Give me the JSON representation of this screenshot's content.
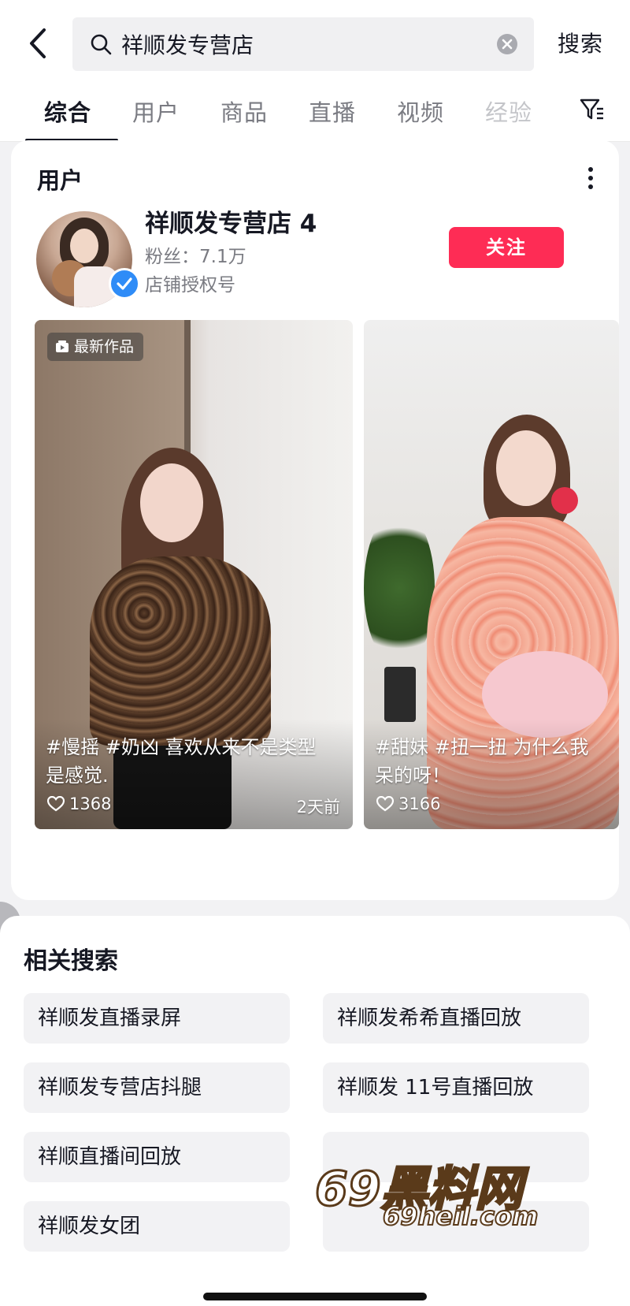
{
  "search": {
    "query": "祥顺发专营店",
    "button_label": "搜索"
  },
  "tabs": [
    {
      "label": "综合",
      "active": true
    },
    {
      "label": "用户",
      "active": false
    },
    {
      "label": "商品",
      "active": false
    },
    {
      "label": "直播",
      "active": false
    },
    {
      "label": "视频",
      "active": false
    },
    {
      "label": "经验",
      "active": false
    }
  ],
  "user_section": {
    "title": "用户",
    "user": {
      "name": "祥顺发专营店 4",
      "fans": "粉丝：7.1万",
      "tag": "店铺授权号",
      "verified": true
    },
    "follow_label": "关注"
  },
  "videos": [
    {
      "badge": "最新作品",
      "caption_line1": "#慢摇 #奶凶 喜欢从来不是类型",
      "caption_line2": "是感觉.",
      "likes": "1368",
      "time": "2天前"
    },
    {
      "badge": "",
      "caption_line1": "#甜妹 #扭一扭 为什么我",
      "caption_line2": "呆的呀！",
      "likes": "3166",
      "time": ""
    }
  ],
  "related": {
    "title": "相关搜索",
    "items": [
      "祥顺发直播录屏",
      "祥顺发希希直播回放",
      "祥顺发专营店抖腿",
      "祥顺发 11号直播回放",
      "祥顺直播间回放",
      "",
      "祥顺发女团",
      ""
    ]
  },
  "watermark": {
    "big": "69黑料网",
    "small": "69heil.com"
  },
  "colors": {
    "accent": "#fe2c55",
    "verified": "#2f8cf7",
    "text_primary": "#161823",
    "text_secondary": "#7a7b82"
  },
  "icons": [
    "back-arrow-icon",
    "search-icon",
    "clear-icon",
    "filter-icon",
    "more-icon",
    "verified-check-icon",
    "video-badge-icon",
    "heart-icon",
    "chevron-right-icon"
  ]
}
